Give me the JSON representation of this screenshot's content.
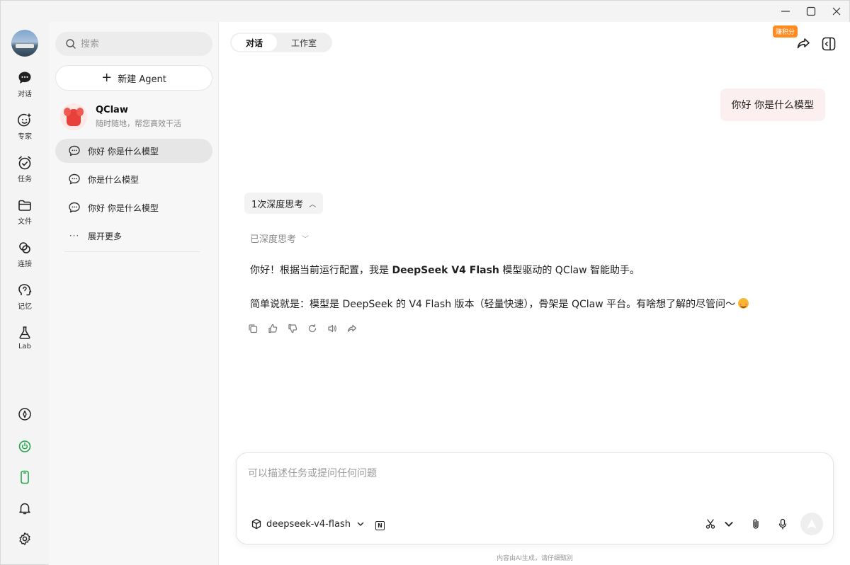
{
  "rail": {
    "items": [
      {
        "label": "对话",
        "icon": "chat-bubble-icon"
      },
      {
        "label": "专家",
        "icon": "smile-badge-icon"
      },
      {
        "label": "任务",
        "icon": "alarm-check-icon"
      },
      {
        "label": "文件",
        "icon": "folder-icon"
      },
      {
        "label": "连接",
        "icon": "link-icon"
      },
      {
        "label": "记忆",
        "icon": "brain-head-icon"
      },
      {
        "label": "Lab",
        "icon": "flask-icon"
      }
    ],
    "bottom_icons": [
      "compass-icon",
      "leaf-power-icon",
      "phone-icon",
      "bell-icon",
      "gear-icon"
    ],
    "accent_green": "#22a74a"
  },
  "sidebar": {
    "search_placeholder": "搜索",
    "new_agent_label": "新建 Agent",
    "agent": {
      "name": "QClaw",
      "subtitle": "随时随地，帮您高效干活"
    },
    "conversations": [
      {
        "label": "你好 你是什么模型",
        "active": true
      },
      {
        "label": "你是什么模型",
        "active": false
      },
      {
        "label": "你好 你是什么模型",
        "active": false
      }
    ],
    "expand_more_label": "展开更多"
  },
  "main": {
    "tabs": [
      {
        "label": "对话",
        "active": true
      },
      {
        "label": "工作室",
        "active": false
      }
    ],
    "points_badge": "赚积分",
    "user_message": "你好 你是什么模型",
    "thinking_chip": "1次深度思考",
    "thought_label": "已深度思考",
    "reply": {
      "line1_prefix": "你好！根据当前运行配置，我是 ",
      "line1_bold": "DeepSeek V4 Flash",
      "line1_suffix": " 模型驱动的 QClaw 智能助手。",
      "line2": "简单说就是：模型是 DeepSeek 的 V4 Flash 版本（轻量快速），骨架是 QClaw 平台。有啥想了解的尽管问～"
    },
    "composer": {
      "placeholder": "可以描述任务或提问任何问题",
      "model": "deepseek-v4-flash"
    },
    "footer_note": "内容由AI生成，请仔细甄别"
  }
}
